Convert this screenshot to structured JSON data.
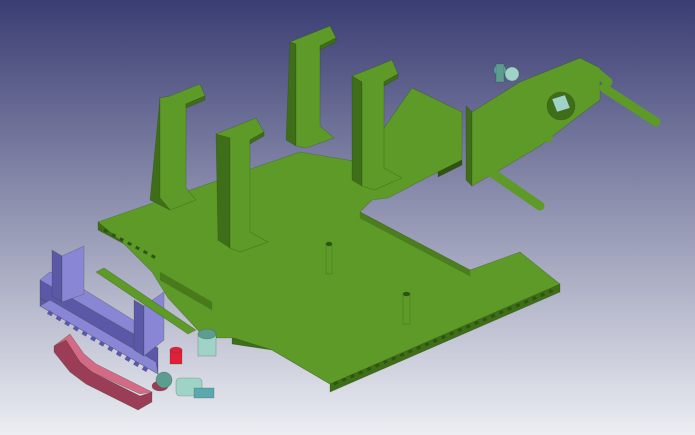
{
  "viewport": {
    "background": {
      "top": "#3a3d72",
      "bottom": "#eceef3"
    }
  },
  "model": {
    "colors": {
      "base_plate": "#5e9a27",
      "base_plate_dark": "#3f6e18",
      "base_plate_edge": "#2e5410",
      "clamp": "#8a86d6",
      "clamp_dark": "#5c58a8",
      "handle": "#d46a86",
      "handle_dark": "#9c3d57",
      "fitting": "#9fd3c7",
      "fitting_dark": "#5d9c91",
      "bolt": "#5aa9b0",
      "red_knob": "#e0203a"
    },
    "parts": [
      "base-plate",
      "support-bracket",
      "front-clamp",
      "handle",
      "rear-mount",
      "pins",
      "fittings"
    ]
  }
}
